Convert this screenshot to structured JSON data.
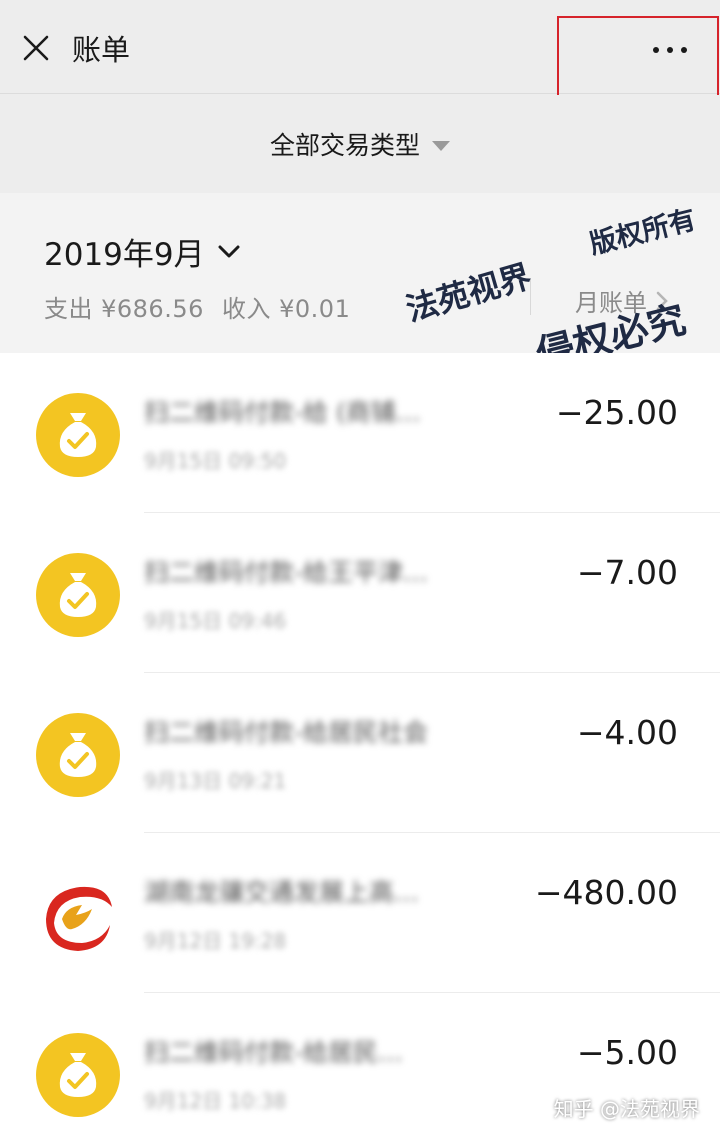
{
  "header": {
    "title": "账单"
  },
  "filter": {
    "label": "全部交易类型"
  },
  "month": {
    "label": "2019年9月",
    "expense_label": "支出 ¥686.56",
    "income_label": "收入 ¥0.01",
    "monthly_bill_label": "月账单"
  },
  "transactions": [
    {
      "icon": "money-bag-icon",
      "name": "扫二维码付款-给 (商铺…",
      "time": "9月15日 09:50",
      "amount": "−25.00"
    },
    {
      "icon": "money-bag-icon",
      "name": "扫二维码付款-给王平津…",
      "time": "9月15日 09:46",
      "amount": "−7.00"
    },
    {
      "icon": "money-bag-icon",
      "name": "扫二维码付款-给居民社会",
      "time": "9月13日 09:21",
      "amount": "−4.00"
    },
    {
      "icon": "merchant-logo-icon",
      "name": "湖南龙骧交通发展上高…",
      "time": "9月12日 19:28",
      "amount": "−480.00"
    },
    {
      "icon": "money-bag-icon",
      "name": "扫二维码付款-给居民…",
      "time": "9月12日 10:38",
      "amount": "−5.00"
    }
  ],
  "watermarks": {
    "top": "版权所有",
    "middle": "法苑视界",
    "bottom": "侵权必究"
  },
  "credit": "知乎 @法苑视界",
  "colors": {
    "accent_yellow": "#f3c522",
    "highlight_red": "#d6232b",
    "logo_red": "#d9271f"
  }
}
